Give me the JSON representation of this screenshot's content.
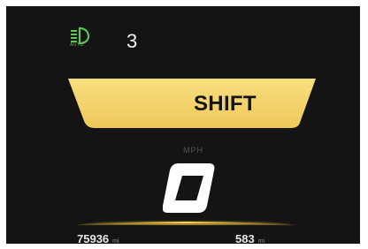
{
  "colors": {
    "background": "#141414",
    "accent_yellow": "#f3d36a",
    "indicator_green": "#5cc25a",
    "text_primary": "#f2f2f2",
    "text_dim": "#555555"
  },
  "status_bar": {
    "headlight_icon": "auto-headlight-icon",
    "headlight_mode": "AUTO",
    "gear": "3"
  },
  "shift_indicator": {
    "label": "SHIFT"
  },
  "speed": {
    "unit": "MPH",
    "value": "0"
  },
  "footer": {
    "odometer": "75936",
    "odometer_unit": "mi",
    "range": "583",
    "range_unit": "mi"
  }
}
